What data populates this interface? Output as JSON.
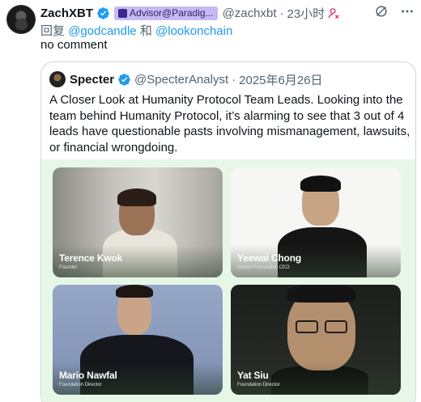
{
  "tweet": {
    "author_name": "ZachXBT",
    "affiliation_badge": "Advisor@Paradig...",
    "handle": "@zachxbt",
    "separator": "·",
    "time": "23小时",
    "reply_prefix": "回复",
    "reply_mentions": [
      "@godcandle",
      "@lookonchain"
    ],
    "reply_joiner": "和",
    "text": "no comment"
  },
  "quote": {
    "author_name": "Specter",
    "handle": "@SpecterAnalyst",
    "separator": "·",
    "date": "2025年6月26日",
    "text": "A Closer Look at Humanity Protocol Team Leads. Looking into the team behind Humanity Protocol, it’s alarming to see that 3 out of 4 leads have questionable pasts involving mismanagement, lawsuits, or financial wrongdoing.",
    "media": {
      "cards": [
        {
          "name": "Terence Kwok",
          "role": "Founder"
        },
        {
          "name": "Yeewai Chong",
          "role": "Interim Foundation CEO"
        },
        {
          "name": "Mario Nawfal",
          "role": "Foundation Director"
        },
        {
          "name": "Yat Siu",
          "role": "Foundation Director"
        }
      ],
      "background_color": "#e7f7e7"
    }
  },
  "colors": {
    "verified": "#1d9bf0",
    "mention": "#1d9bf0",
    "secondary_text": "#536471",
    "affiliation_badge_bg": "#c7b9f4"
  },
  "icons": {
    "verified": "verified-badge-icon",
    "person": "person-x-icon",
    "grok": "grok-icon",
    "more": "more-icon"
  }
}
